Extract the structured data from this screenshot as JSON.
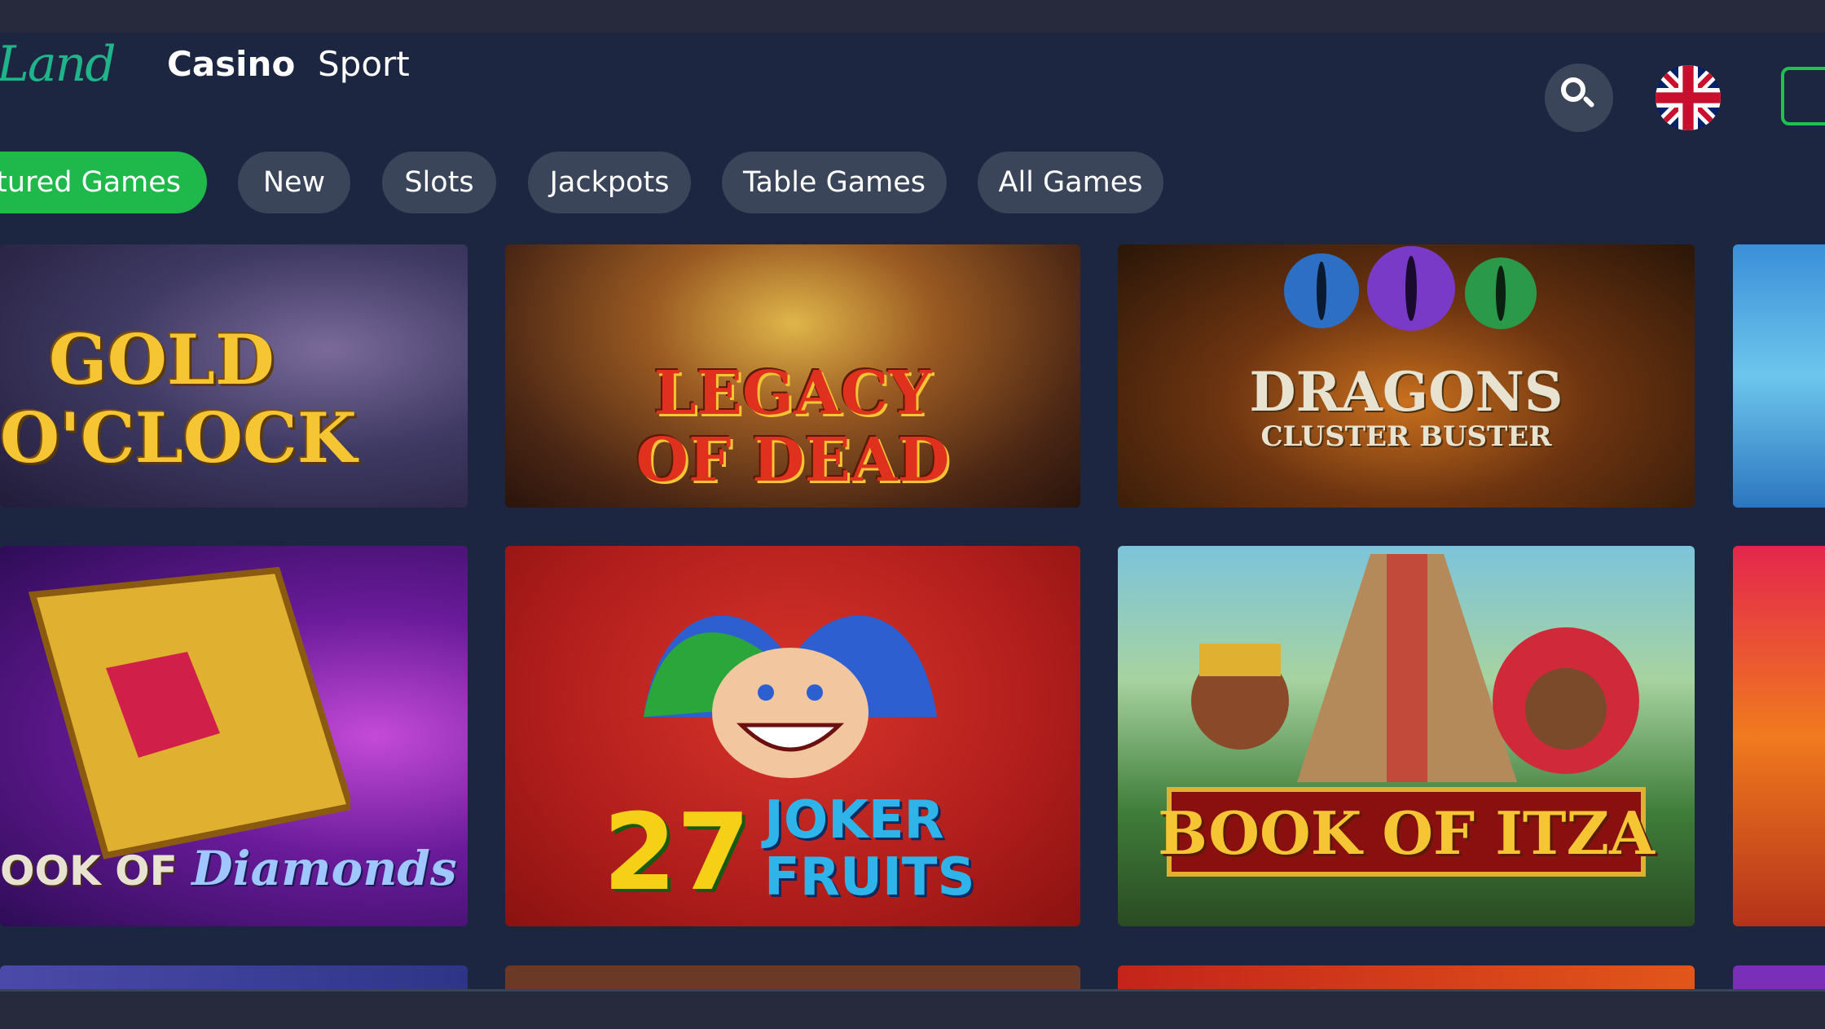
{
  "header": {
    "logo_visible": "Land",
    "logo_partial": "",
    "nav": [
      "Casino",
      "Sport"
    ],
    "icons": [
      "search-icon",
      "uk-flag-icon"
    ]
  },
  "tabs": [
    {
      "label": "atured Games",
      "active": true
    },
    {
      "label": "New",
      "active": false
    },
    {
      "label": "Slots",
      "active": false
    },
    {
      "label": "Jackpots",
      "active": false
    },
    {
      "label": "Table Games",
      "active": false
    },
    {
      "label": "All Games",
      "active": false
    }
  ],
  "games": {
    "gold_oclock": {
      "line1": "GOLD",
      "line2": "O'CLOCK"
    },
    "legacy_of_dead": {
      "line1": "LEGACY",
      "line2": "OF DEAD"
    },
    "dragons_cluster_buster": {
      "line1": "DRAGONS",
      "line2": "CLUSTER BUSTER"
    },
    "book_of_diamonds": {
      "prefix": "OOK OF",
      "name": "Diamonds"
    },
    "joker_fruits": {
      "number": "27",
      "line1": "JOKER",
      "line2": "FRUITS"
    },
    "book_of_itza": {
      "title": "BOOK OF ITZA"
    }
  },
  "colors": {
    "background": "#1c2640",
    "tab_inactive": "#3b455a",
    "tab_active": "#1fb84a",
    "accent_green": "#22c04f"
  }
}
